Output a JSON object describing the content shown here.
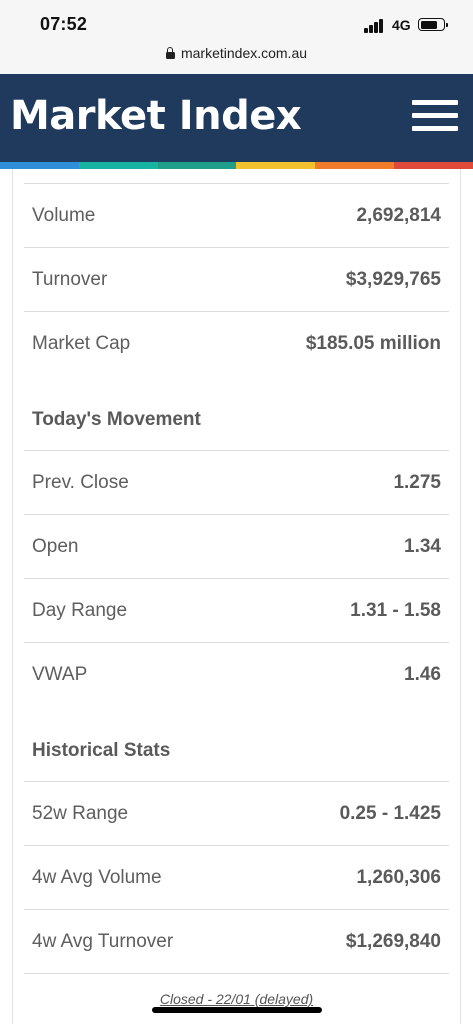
{
  "status_bar": {
    "time": "07:52",
    "network": "4G",
    "icons": [
      "cellular-signal-icon",
      "battery-icon"
    ]
  },
  "browser": {
    "url": "marketindex.com.au",
    "icon": "lock-icon"
  },
  "header": {
    "logo": "Market Index",
    "menu_icon": "hamburger-menu-icon",
    "background": "#1f3a5c",
    "stripe_colors": [
      "#2f8fd8",
      "#17b3a3",
      "#1f9e8a",
      "#f2c12e",
      "#f07c2b",
      "#e04a3a"
    ]
  },
  "stats": {
    "rows_top": [
      {
        "label": "Volume",
        "value": "2,692,814"
      },
      {
        "label": "Turnover",
        "value": "$3,929,765"
      },
      {
        "label": "Market Cap",
        "value": "$185.05 million"
      }
    ],
    "todays_movement": {
      "title": "Today's Movement",
      "rows": [
        {
          "label": "Prev. Close",
          "value": "1.275"
        },
        {
          "label": "Open",
          "value": "1.34"
        },
        {
          "label": "Day Range",
          "value": "1.31 - 1.58"
        },
        {
          "label": "VWAP",
          "value": "1.46"
        }
      ]
    },
    "historical_stats": {
      "title": "Historical Stats",
      "rows": [
        {
          "label": "52w Range",
          "value": "0.25 - 1.425"
        },
        {
          "label": "4w Avg Volume",
          "value": "1,260,306"
        },
        {
          "label": "4w Avg Turnover",
          "value": "$1,269,840"
        }
      ]
    }
  },
  "footer_note": "Closed - 22/01 (delayed)"
}
